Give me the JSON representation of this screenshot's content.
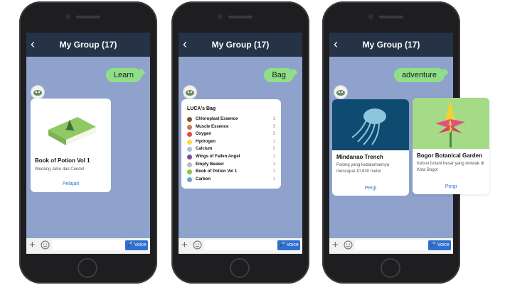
{
  "phones": [
    {
      "header_title": "My Group (17)",
      "message": "Learn",
      "input": {
        "voice_label": "Voice"
      },
      "card": {
        "title": "Book of Potion Vol 1",
        "description": "Wedang Jahe dan Cendol",
        "link": "Pelajari"
      }
    },
    {
      "header_title": "My Group (17)",
      "message": "Bag",
      "input": {
        "voice_label": "Voice"
      },
      "bag": {
        "title": "LUCA's Bag",
        "items": [
          {
            "name": "Chloroplast Essence",
            "count": "1",
            "icon_color": "#7a5a3a"
          },
          {
            "name": "Muscle Essence",
            "count": "3",
            "icon_color": "#c97a4a"
          },
          {
            "name": "Oxygen",
            "count": "3",
            "icon_color": "#e24b4b"
          },
          {
            "name": "Hydrogen",
            "count": "1",
            "icon_color": "#ffd54a"
          },
          {
            "name": "Calcium",
            "count": "2",
            "icon_color": "#9fc3e8"
          },
          {
            "name": "Wings of Fallen Angel",
            "count": "1",
            "icon_color": "#7c4f9e"
          },
          {
            "name": "Empty Beaker",
            "count": "1",
            "icon_color": "#bdbdbd"
          },
          {
            "name": "Book of Potion Vol 1",
            "count": "1",
            "icon_color": "#8fbf4d"
          },
          {
            "name": "Carbon",
            "count": "1",
            "icon_color": "#6fa0d8"
          }
        ]
      }
    },
    {
      "header_title": "My Group (17)",
      "message": "adventure",
      "input": {
        "voice_label": "Voice"
      },
      "cards": [
        {
          "title": "Mindanao Trench",
          "description": "Palung yang kedalamannya mencapai 10.830 meter",
          "link": "Pergi",
          "image_bg": "#0f4a70"
        },
        {
          "title": "Bogor Botanical Garden",
          "description": "Kebun botani besar yang terletak di Kota Bogor",
          "link": "Pergi",
          "image_bg": "#a5db86"
        }
      ]
    }
  ]
}
